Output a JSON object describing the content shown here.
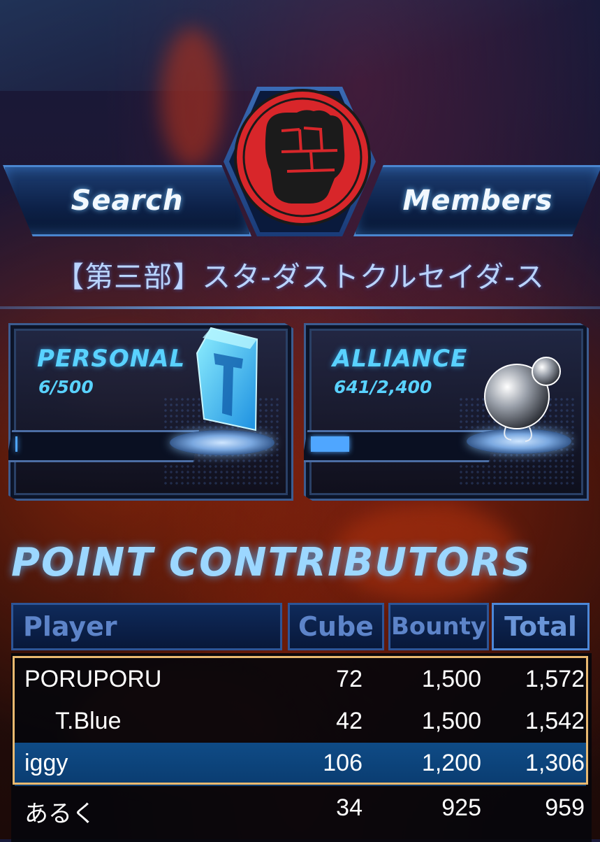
{
  "header": {
    "search_label": "Search",
    "members_label": "Members",
    "alliance_name": "【第三部】スタ-ダストクルセイダ-ス"
  },
  "personal": {
    "title": "PERSONAL",
    "count": "6/500",
    "progress": 0.012
  },
  "alliance": {
    "title": "ALLIANCE",
    "count": "641/2,400",
    "progress": 0.267
  },
  "contributors": {
    "title": "POINT CONTRIBUTORS",
    "columns": {
      "player": "Player",
      "cube": "Cube",
      "bounty": "Bounty",
      "total": "Total"
    },
    "rows": [
      {
        "player": "PORUPORU",
        "cube": "72",
        "bounty": "1,500",
        "total": "1,572"
      },
      {
        "player": "T.Blue",
        "cube": "42",
        "bounty": "1,500",
        "total": "1,542"
      },
      {
        "player": "iggy",
        "cube": "106",
        "bounty": "1,200",
        "total": "1,306"
      },
      {
        "player": "あるく",
        "cube": "34",
        "bounty": "925",
        "total": "959"
      }
    ]
  },
  "colors": {
    "accent": "#59d2ff",
    "highlight_frame": "#e9b970",
    "self_row": "#0f4b86",
    "emblem_red": "#d8262a"
  },
  "icons": {
    "emblem": "fist-emblem-icon",
    "personal": "cube-icon",
    "alliance": "orb-icon"
  }
}
